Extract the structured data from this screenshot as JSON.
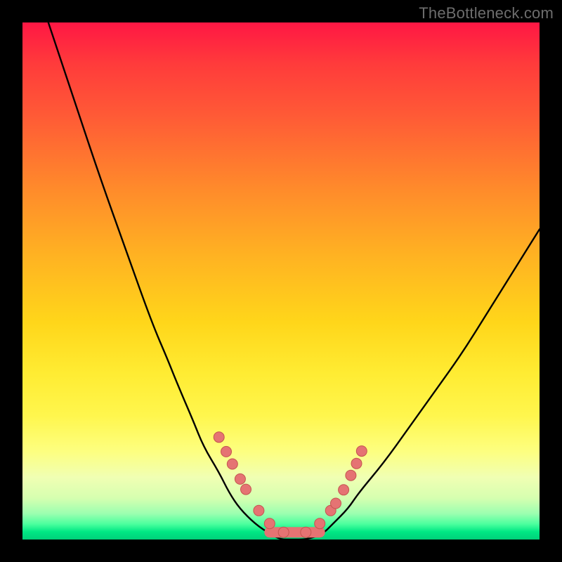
{
  "watermark": "TheBottleneck.com",
  "colors": {
    "frame": "#000000",
    "curve": "#000000",
    "marker_fill": "#e57373",
    "marker_stroke": "#c4544f",
    "gradient_top": "#ff1744",
    "gradient_bottom": "#00d07a"
  },
  "chart_data": {
    "type": "line",
    "title": "",
    "xlabel": "",
    "ylabel": "",
    "x_range": [
      0,
      100
    ],
    "y_range": [
      0,
      100
    ],
    "grid": false,
    "legend": false,
    "notes": "V-shaped bottleneck curve. Y axis inverted visually (100 at top, 0 at bottom). Values estimated from pixel positions; no axis ticks or numeric labels are rendered in the source image.",
    "series": [
      {
        "name": "bottleneck-curve",
        "x": [
          5,
          10,
          15,
          20,
          25,
          28,
          30,
          33,
          35,
          38,
          40,
          42,
          45,
          48,
          50,
          52,
          55,
          58,
          60,
          63,
          65,
          70,
          75,
          80,
          85,
          90,
          95,
          100
        ],
        "y": [
          100,
          85,
          70,
          56,
          42,
          35,
          30,
          23,
          18,
          13,
          9,
          6,
          3,
          1,
          0,
          0,
          0,
          1,
          3,
          6,
          9,
          15,
          22,
          29,
          36,
          44,
          52,
          60
        ]
      }
    ],
    "markers": {
      "name": "highlight-points",
      "x": [
        38.0,
        39.4,
        40.6,
        42.1,
        43.2,
        45.7,
        47.8,
        50.5,
        54.8,
        57.5,
        59.6,
        60.6,
        62.1,
        63.5,
        64.6,
        65.6
      ],
      "y": [
        19.8,
        17.0,
        14.6,
        11.7,
        9.7,
        5.6,
        3.1,
        1.4,
        1.4,
        3.1,
        5.6,
        7.0,
        9.6,
        12.4,
        14.7,
        17.1
      ]
    },
    "flat_segment": {
      "x_start": 47.8,
      "x_end": 57.5,
      "y": 1.4
    }
  }
}
